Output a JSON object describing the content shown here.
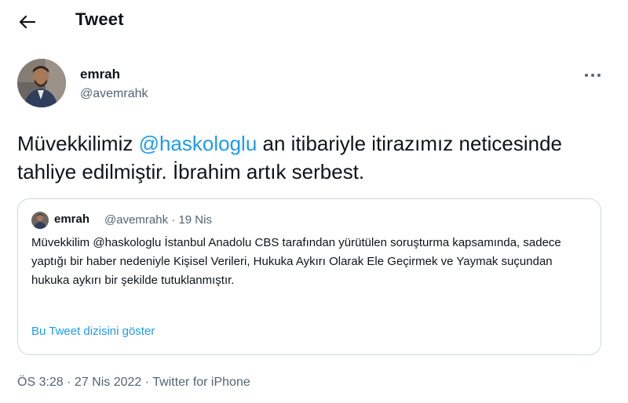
{
  "header": {
    "title": "Tweet",
    "back_icon": "arrow-left-icon"
  },
  "tweet": {
    "author_name": "emrah",
    "author_handle": "@avemrahk",
    "more_icon": "more-horizontal-icon",
    "text_part1": "Müvekkilimiz ",
    "mention": "@haskologlu",
    "text_part2": " an itibariyle itirazımız neticesinde tahliye edilmiştir. İbrahim artık serbest.",
    "time": "ÖS 3:28",
    "separator1": " · ",
    "date": "27 Nis 2022",
    "separator2": " · ",
    "source": "Twitter for iPhone"
  },
  "quoted_tweet": {
    "author_name": "emrah",
    "author_handle": "@avemrahk",
    "separator": " · ",
    "date": "19 Nis",
    "text": "Müvekkilim @haskologlu İstanbul Anadolu CBS tarafından yürütülen soruşturma kapsamında, sadece yaptığı bir haber nedeniyle Kişisel Verileri, Hukuka Aykırı Olarak Ele Geçirmek ve Yaymak suçundan hukuka aykırı bir şekilde tutuklanmıştır.",
    "thread_link": "Bu Tweet dizisini göster"
  },
  "colors": {
    "accent": "#1d9bf0",
    "text_primary": "#0f1419",
    "text_secondary": "#536471",
    "border": "#cfd9de"
  }
}
